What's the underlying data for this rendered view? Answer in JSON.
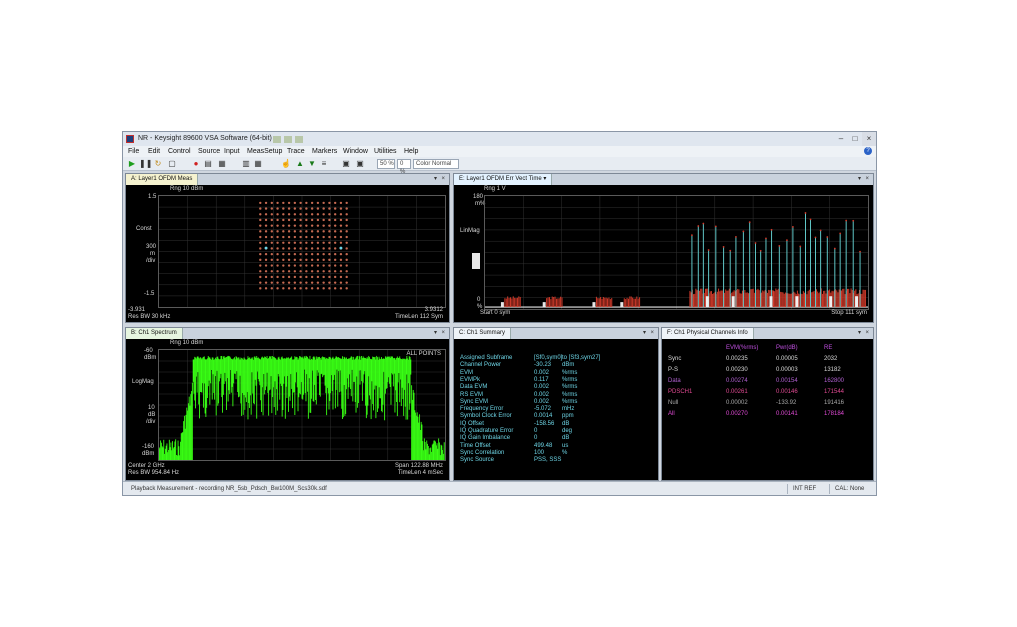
{
  "window": {
    "title": "NR - Keysight 89600 VSA Software (64-bit)",
    "minimize": "–",
    "maximize": "□",
    "close": "×"
  },
  "menu": [
    "File",
    "Edit",
    "Control",
    "Source",
    "Input",
    "MeasSetup",
    "Trace",
    "Markers",
    "Window",
    "Utilities",
    "Help"
  ],
  "toolbar": {
    "zoom1": "50 %",
    "zoom2": "0 %",
    "color_mode": "Color Normal"
  },
  "pane_a": {
    "tab": "A: Layer1 OFDM Meas",
    "range": "Rng 10 dBm",
    "y_top": "1.5",
    "y_label": "Const",
    "y_div1": "300",
    "y_div2": "m",
    "y_div3": "/div",
    "y_bottom": "-1.5",
    "x_left": "-3.931",
    "x_right": "3.9312",
    "res_bw": "Res BW 30 kHz",
    "time_len": "TimeLen 112  Sym"
  },
  "pane_b": {
    "tab": "B: Ch1 Spectrum",
    "range": "Rng 10 dBm",
    "y_top": "-60",
    "y_top_unit": "dBm",
    "y_label": "LogMag",
    "y_div1": "10",
    "y_div2": "dB",
    "y_div3": "/div",
    "y_bottom": "-160",
    "y_bottom_unit": "dBm",
    "all_points": "ALL POINTS",
    "center": "Center 2 GHz",
    "res_bw": "Res BW 954.84  Hz",
    "span": "Span 122.88 MHz",
    "time_len": "TimeLen 4  mSec"
  },
  "pane_c": {
    "tab": "C: Ch1 Summary",
    "rows": [
      {
        "label": "Assigned  Subframe",
        "value": "[Sf0,sym0]",
        "unit": "to  [Sf3,sym27]"
      },
      {
        "label": "Channel  Power",
        "value": "-30.23",
        "unit": "dBm"
      },
      {
        "label": "EVM",
        "value": "0.002",
        "unit": "%rms"
      },
      {
        "label": "EVMPk",
        "value": "0.117",
        "unit": "%rms"
      },
      {
        "label": "Data  EVM",
        "value": "0.002",
        "unit": "%rms"
      },
      {
        "label": "RS EVM",
        "value": "0.002",
        "unit": "%rms"
      },
      {
        "label": "Sync EVM",
        "value": "0.002",
        "unit": "%rms"
      },
      {
        "label": "Frequency  Error",
        "value": "-5.072",
        "unit": "mHz"
      },
      {
        "label": "Symbol Clock  Error",
        "value": "0.0014",
        "unit": "ppm"
      },
      {
        "label": "IQ  Offset",
        "value": "-158.56",
        "unit": "dB"
      },
      {
        "label": "IQ  Quadrature  Error",
        "value": "0",
        "unit": "deg"
      },
      {
        "label": "IQ  Gain  Imbalance",
        "value": "0",
        "unit": "dB"
      },
      {
        "label": "Time  Offset",
        "value": "499.48",
        "unit": "us"
      },
      {
        "label": "Sync Correlation",
        "value": "100",
        "unit": "%"
      },
      {
        "label": "Sync Source",
        "value": "PSS,  SSS",
        "unit": ""
      }
    ]
  },
  "pane_e": {
    "tab": "E: Layer1 OFDM Err Vect Time",
    "range": "Rng 1  V",
    "y_top": "180",
    "y_top_unit": "m%",
    "y_label": "LinMag",
    "y_bottom": "0",
    "y_bottom_unit": "%",
    "start": "Start 0  sym",
    "stop": "Stop 111  sym"
  },
  "pane_f": {
    "tab": "F: Ch1 Physical Channels Info",
    "headers": [
      "EVM(%rms)",
      "Pwr(dB)",
      "RE"
    ],
    "rows": [
      {
        "name": "Sync",
        "evm": "0.00235",
        "pwr": "0.00005",
        "re": "2032",
        "color": "#d9d9d9"
      },
      {
        "name": "P-S",
        "evm": "0.00230",
        "pwr": "0.00003",
        "re": "13182",
        "color": "#d9d9d9"
      },
      {
        "name": "Data",
        "evm": "0.00274",
        "pwr": "0.00154",
        "re": "162800",
        "color": "#b060d0"
      },
      {
        "name": "PDSCH1",
        "evm": "0.00261",
        "pwr": "0.00146",
        "re": "171544",
        "color": "#e04a92"
      },
      {
        "name": "Null",
        "evm": "0.00002",
        "pwr": "-133.92",
        "re": "191416",
        "color": "#a8a8a8"
      },
      {
        "name": "All",
        "evm": "0.00270",
        "pwr": "0.00141",
        "re": "178184",
        "color": "#e04ad6"
      }
    ]
  },
  "status": {
    "message": "Playback Measurement - recording NR_5sb_Pdsch_Bw100M_Scs30k.sdf",
    "int_ref": "INT REF",
    "cal": "CAL: None"
  },
  "colors": {
    "spectrum": "#39ff14",
    "constellation": "#c46a52",
    "evm_bars_cyan": "#60c8c8",
    "evm_bars_red": "#d23a2a"
  }
}
